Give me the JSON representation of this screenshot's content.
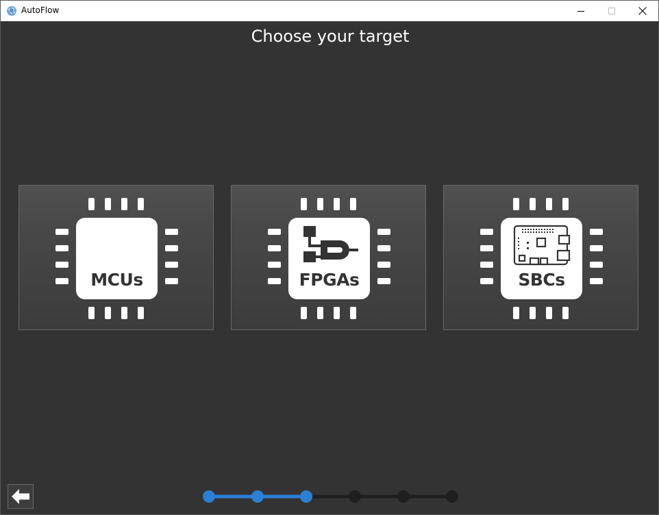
{
  "window": {
    "title": "AutoFlow",
    "controls": {
      "minimize": "minimize-icon",
      "maximize": "maximize-icon",
      "close": "close-icon"
    }
  },
  "page": {
    "heading": "Choose your target"
  },
  "targets": [
    {
      "label": "MCUs",
      "icon": "mcu-chip-icon"
    },
    {
      "label": "FPGAs",
      "icon": "fpga-logic-icon"
    },
    {
      "label": "SBCs",
      "icon": "sbc-board-icon"
    }
  ],
  "navigation": {
    "back_icon": "arrow-left-icon"
  },
  "progress": {
    "total_steps": 6,
    "completed_steps": 3,
    "active_color": "#2b7fd4",
    "inactive_color": "#1f1f1f"
  },
  "colors": {
    "background": "#333333",
    "accent": "#2b7fd4"
  }
}
